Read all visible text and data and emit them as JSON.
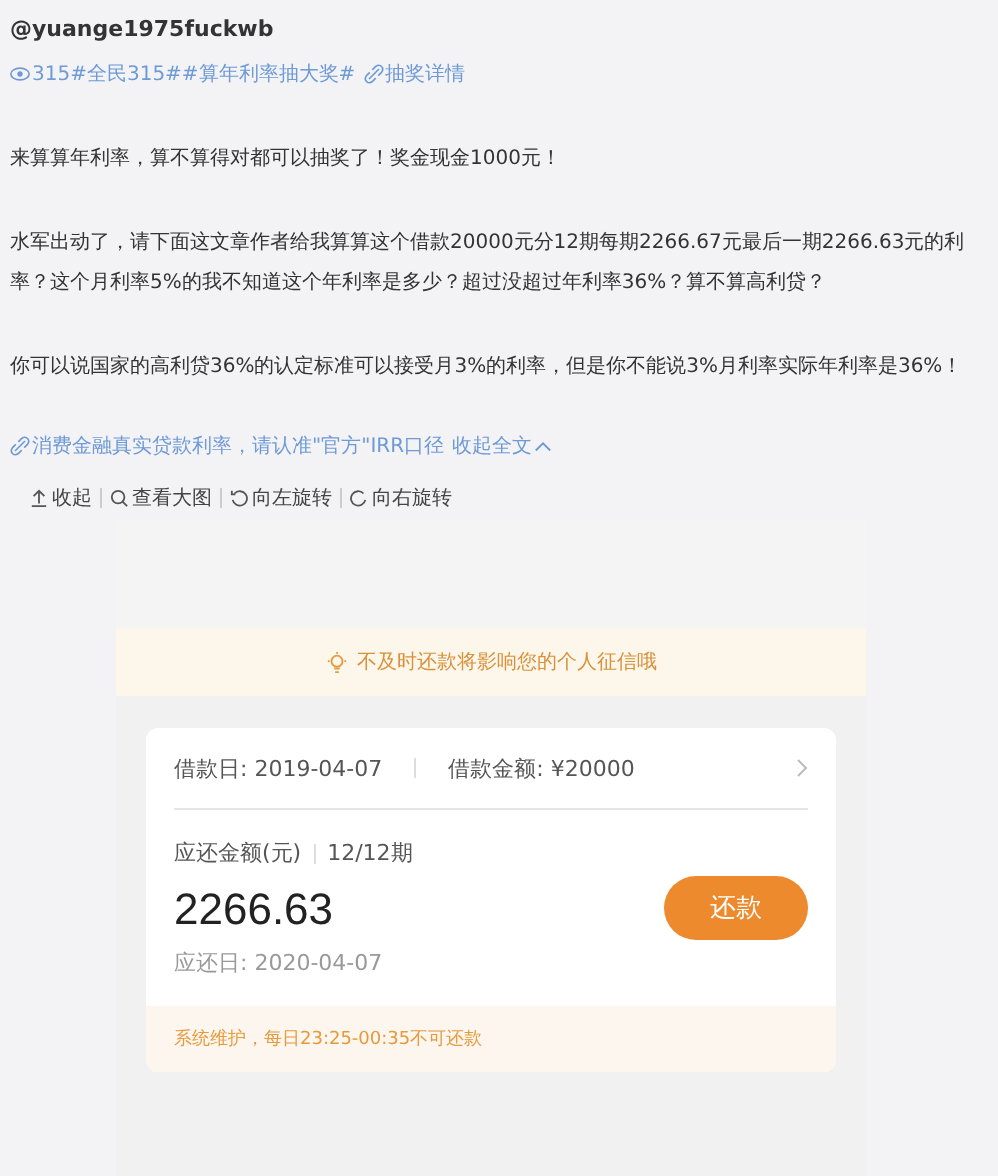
{
  "author": "@yuange1975fuckwb",
  "tags": {
    "topics": "315#全民315##算年利率抽大奖#",
    "link": "抽奖详情"
  },
  "paragraphs": [
    "来算算年利率，算不算得对都可以抽奖了！奖金现金1000元！",
    "水军出动了，请下面这文章作者给我算算这个借款20000元分12期每期2266.67元最后一期2266.63元的利率？这个月利率5%的我不知道这个年利率是多少？超过没超过年利率36%？算不算高利贷？",
    "你可以说国家的高利贷36%的认定标准可以接受月3%的利率，但是你不能说3%月利率实际年利率是36%！"
  ],
  "footer_link": {
    "text": "消费金融真实贷款利率，请认准\"官方\"IRR口径",
    "collapse": "收起全文"
  },
  "image_toolbar": [
    {
      "kind": "collapse",
      "label": "收起"
    },
    {
      "kind": "zoom",
      "label": "查看大图"
    },
    {
      "kind": "rotate_left",
      "label": "向左旋转"
    },
    {
      "kind": "rotate_right",
      "label": "向右旋转"
    }
  ],
  "app": {
    "notice": "不及时还款将影响您的个人征信哦",
    "loan_date": "借款日: 2019-04-07",
    "loan_amount": "借款金额: ¥20000",
    "due_label": "应还金额(元)",
    "period": "12/12期",
    "amount": "2266.63",
    "due_date": "应还日: 2020-04-07",
    "repay_button": "还款",
    "maintenance": "系统维护，每日23:25-00:35不可还款"
  }
}
